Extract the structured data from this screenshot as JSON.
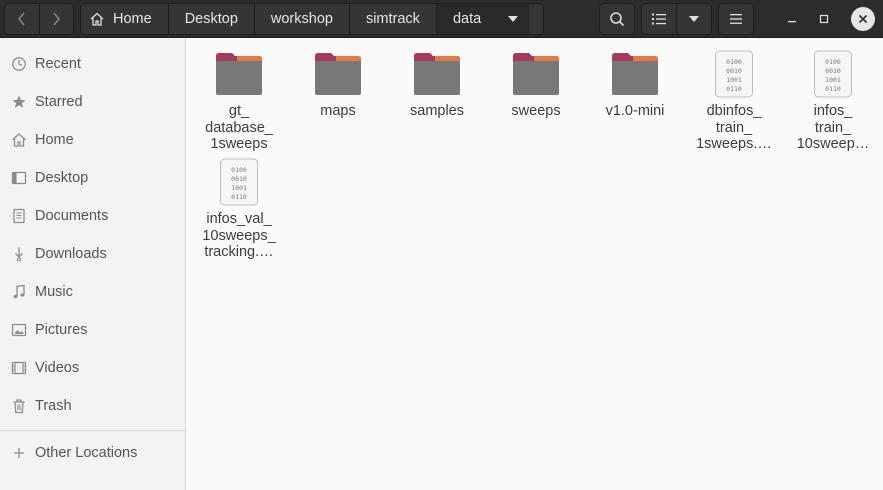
{
  "pathbar": {
    "crumbs": [
      "Home",
      "Desktop",
      "workshop",
      "simtrack",
      "data"
    ]
  },
  "sidebar": {
    "items": [
      {
        "label": "Recent",
        "icon": "clock-icon"
      },
      {
        "label": "Starred",
        "icon": "star-icon"
      },
      {
        "label": "Home",
        "icon": "home-icon"
      },
      {
        "label": "Desktop",
        "icon": "desktop-icon"
      },
      {
        "label": "Documents",
        "icon": "document-icon"
      },
      {
        "label": "Downloads",
        "icon": "download-icon"
      },
      {
        "label": "Music",
        "icon": "music-icon"
      },
      {
        "label": "Pictures",
        "icon": "picture-icon"
      },
      {
        "label": "Videos",
        "icon": "video-icon"
      },
      {
        "label": "Trash",
        "icon": "trash-icon"
      }
    ],
    "other_locations": {
      "label": "Other Locations",
      "icon": "plus-icon"
    }
  },
  "files": [
    {
      "type": "folder",
      "lines": [
        "gt_",
        "database_",
        "1sweeps"
      ]
    },
    {
      "type": "folder",
      "lines": [
        "maps"
      ]
    },
    {
      "type": "folder",
      "lines": [
        "samples"
      ]
    },
    {
      "type": "folder",
      "lines": [
        "sweeps"
      ]
    },
    {
      "type": "folder",
      "lines": [
        "v1.0-mini"
      ]
    },
    {
      "type": "binary",
      "lines": [
        "dbinfos_",
        "train_",
        "1sweeps.…"
      ]
    },
    {
      "type": "binary",
      "lines": [
        "infos_",
        "train_",
        "10sweep…"
      ]
    },
    {
      "type": "binary",
      "lines": [
        "infos_val_",
        "10sweeps_",
        "tracking.…"
      ]
    }
  ],
  "colors": {
    "header_bg": "#2c2c2c",
    "folder_tab": "#a23c5c",
    "folder_body": "#787878",
    "folder_accent": "#e07a4a"
  }
}
